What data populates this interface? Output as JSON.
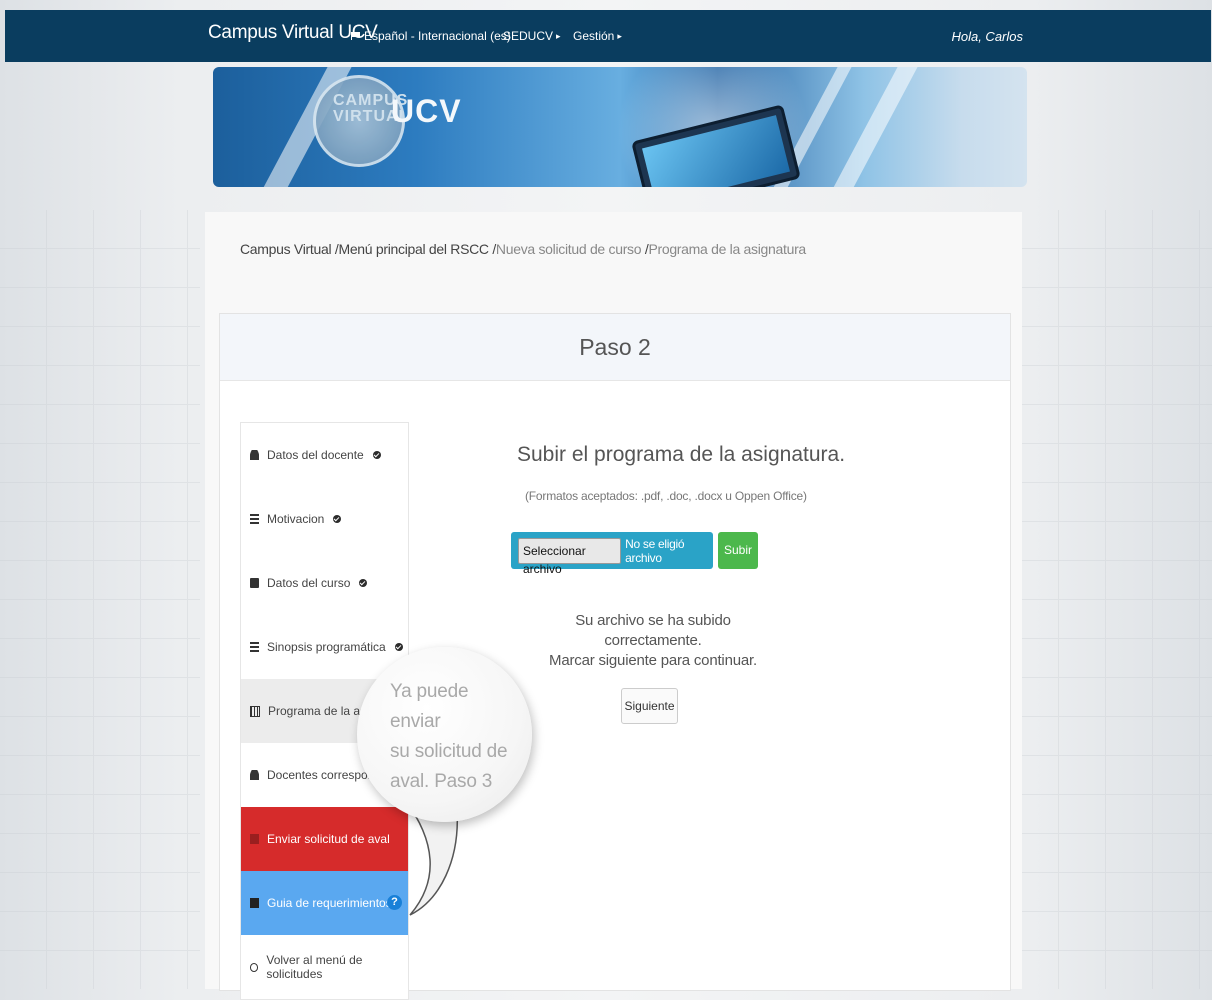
{
  "topbar": {
    "brand": "Campus Virtual UCV",
    "language": "Español - Internacional (es)",
    "seducv": "SEDUCV",
    "gestion": "Gestión",
    "greeting": "Hola, Carlos"
  },
  "banner": {
    "logo_line1": "CAMPUS",
    "logo_line2": "VIRTUAL",
    "logo_ucv": "UCV"
  },
  "breadcrumb": {
    "items": [
      "Campus Virtual",
      "Menú principal del RSCC",
      "Nueva solicitud de curso",
      "Programa de la asignatura"
    ],
    "separator": "/"
  },
  "card": {
    "title": "Paso 2"
  },
  "sidebar": {
    "items": [
      {
        "label": "Datos del docente",
        "icon": "user-icon",
        "done": true
      },
      {
        "label": "Motivacion",
        "icon": "list-icon",
        "done": true
      },
      {
        "label": "Datos del curso",
        "icon": "book-icon",
        "done": true
      },
      {
        "label": "Sinopsis programática",
        "icon": "list-icon",
        "done": true
      },
      {
        "label": "Programa de la asigna",
        "icon": "table-icon",
        "done": false
      },
      {
        "label": "Docentes corresponsa",
        "icon": "user-icon",
        "done": false
      },
      {
        "label": "Enviar solicitud de aval",
        "icon": "envelope-icon",
        "done": false
      },
      {
        "label": "Guia de requerimientos",
        "icon": "file-icon",
        "done": false,
        "help": "?"
      },
      {
        "label": "Volver al menú de solicitudes",
        "icon": "back-icon",
        "done": false
      }
    ]
  },
  "upload": {
    "title": "Subir el programa de la asignatura.",
    "formats": "(Formatos aceptados: .pdf, .doc, .docx u Oppen Office)",
    "choose_button": "Seleccionar archivo",
    "no_file": "No se eligió archivo",
    "submit": "Subir",
    "success_line1": "Su archivo se ha subido correctamente.",
    "success_line2": "Marcar siguiente para continuar.",
    "next": "Siguiente"
  },
  "tooltip": {
    "line1": "Ya puede enviar",
    "line2": "su solicitud de",
    "line3": "aval.  Paso 3"
  },
  "colors": {
    "topbar": "#0a3d5f",
    "send_item": "#d62b2b",
    "guide_item": "#5aa8f0",
    "submit": "#4cb84c",
    "file_input": "#2aa3c7"
  }
}
